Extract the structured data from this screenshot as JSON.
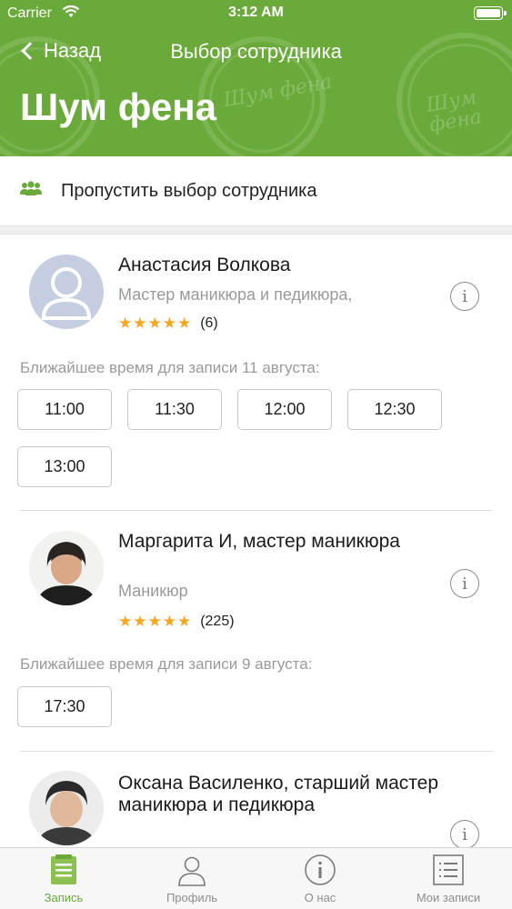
{
  "status_bar": {
    "carrier": "Carrier",
    "time": "3:12 AM"
  },
  "nav": {
    "back_label": "Назад",
    "title": "Выбор сотрудника",
    "large_title": "Шум фена"
  },
  "brand_watermark": "Шум фена",
  "skip": {
    "label": "Пропустить выбор сотрудника",
    "icon": "group-icon"
  },
  "employees": [
    {
      "name": "Анастасия Волкова",
      "role": "Мастер маникюра и педикюра,",
      "stars": "★★★★★",
      "reviews": "(6)",
      "nearest_label": "Ближайшее время для записи 11 августа:",
      "slots": [
        "11:00",
        "11:30",
        "12:00",
        "12:30",
        "13:00"
      ]
    },
    {
      "name": "Маргарита И, мастер маникюра",
      "role": "Маникюр",
      "stars": "★★★★★",
      "reviews": "(225)",
      "nearest_label": "Ближайшее время для записи 9 августа:",
      "slots": [
        "17:30"
      ]
    },
    {
      "name": "Оксана Василенко, старший мастер маникюра и педикюра"
    }
  ],
  "info_glyph": "i",
  "tabs": [
    {
      "label": "Запись",
      "icon": "booking-list-icon",
      "active": true
    },
    {
      "label": "Профиль",
      "icon": "profile-icon",
      "active": false
    },
    {
      "label": "О нас",
      "icon": "info-icon",
      "active": false
    },
    {
      "label": "Мои записи",
      "icon": "my-records-icon",
      "active": false
    }
  ],
  "colors": {
    "brand_green": "#6aaa3a",
    "star": "#f5a623",
    "muted_text": "#9a9a9a"
  }
}
